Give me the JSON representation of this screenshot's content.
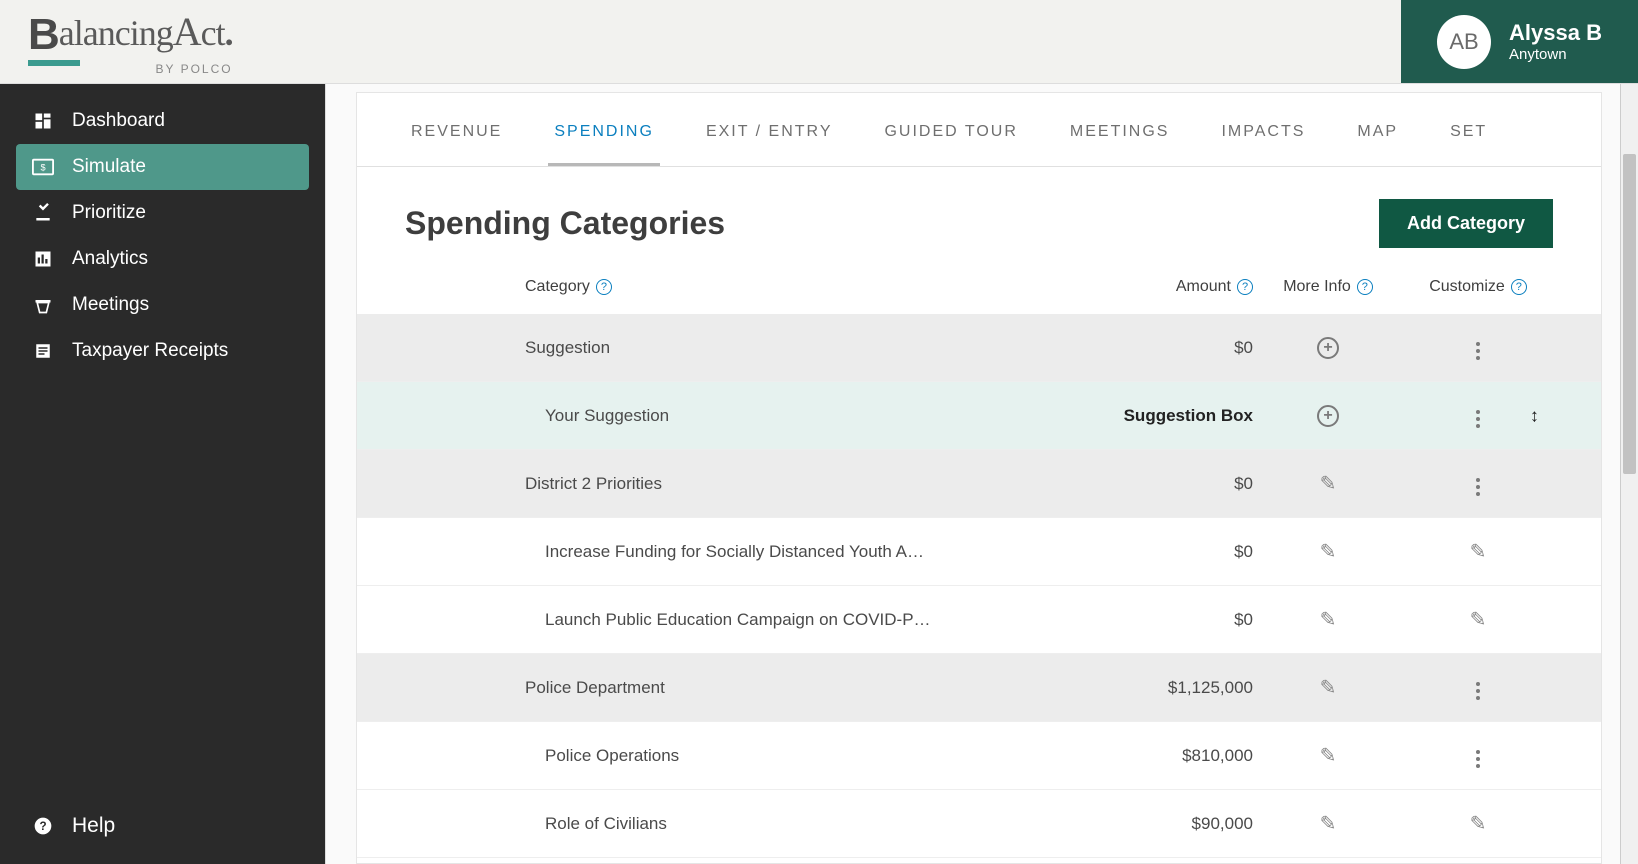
{
  "brand": {
    "main_html_parts": {
      "b": "B",
      "rest1": "alancing",
      "a": "A",
      "rest2": "ct",
      "dot": "."
    },
    "sub": "BY  POLCO"
  },
  "user": {
    "initials": "AB",
    "name": "Alyssa B",
    "org": "Anytown"
  },
  "sidebar": {
    "items": [
      {
        "label": "Dashboard",
        "icon": "dashboard-icon",
        "active": false
      },
      {
        "label": "Simulate",
        "icon": "money-box-icon",
        "active": true
      },
      {
        "label": "Prioritize",
        "icon": "vote-icon",
        "active": false
      },
      {
        "label": "Analytics",
        "icon": "bar-chart-icon",
        "active": false
      },
      {
        "label": "Meetings",
        "icon": "podium-icon",
        "active": false
      },
      {
        "label": "Taxpayer Receipts",
        "icon": "receipt-icon",
        "active": false
      }
    ],
    "help_label": "Help"
  },
  "tabs": [
    {
      "label": "REVENUE",
      "active": false
    },
    {
      "label": "SPENDING",
      "active": true
    },
    {
      "label": "EXIT / ENTRY",
      "active": false
    },
    {
      "label": "GUIDED TOUR",
      "active": false
    },
    {
      "label": "MEETINGS",
      "active": false
    },
    {
      "label": "IMPACTS",
      "active": false
    },
    {
      "label": "MAP",
      "active": false
    },
    {
      "label": "SET",
      "active": false
    }
  ],
  "heading": "Spending Categories",
  "add_button": "Add Category",
  "columns": {
    "category": "Category",
    "amount": "Amount",
    "more": "More Info",
    "customize": "Customize"
  },
  "rows": [
    {
      "type": "group",
      "category": "Suggestion",
      "amount": "$0",
      "more_icon": "plus",
      "cust_icon": "dots"
    },
    {
      "type": "highlight",
      "indent": 1,
      "category": "Your Suggestion",
      "amount": "Suggestion Box",
      "amount_bold": true,
      "more_icon": "plus",
      "cust_icon": "dots",
      "drag_cursor": true
    },
    {
      "type": "group",
      "category": "District 2 Priorities",
      "amount": "$0",
      "more_icon": "pencil",
      "cust_icon": "dots"
    },
    {
      "type": "sub",
      "indent": 1,
      "category": "Increase Funding for Socially Distanced Youth A…",
      "amount": "$0",
      "more_icon": "pencil",
      "cust_icon": "pencil"
    },
    {
      "type": "sub",
      "indent": 1,
      "category": "Launch Public Education Campaign on COVID-P…",
      "amount": "$0",
      "more_icon": "pencil",
      "cust_icon": "pencil"
    },
    {
      "type": "group",
      "category": "Police Department",
      "amount": "$1,125,000",
      "more_icon": "pencil",
      "cust_icon": "dots"
    },
    {
      "type": "sub",
      "indent": 1,
      "category": "Police Operations",
      "amount": "$810,000",
      "more_icon": "pencil",
      "cust_icon": "dots"
    },
    {
      "type": "sub",
      "indent": 1,
      "category": "Role of Civilians",
      "amount": "$90,000",
      "more_icon": "pencil",
      "cust_icon": "pencil"
    }
  ]
}
